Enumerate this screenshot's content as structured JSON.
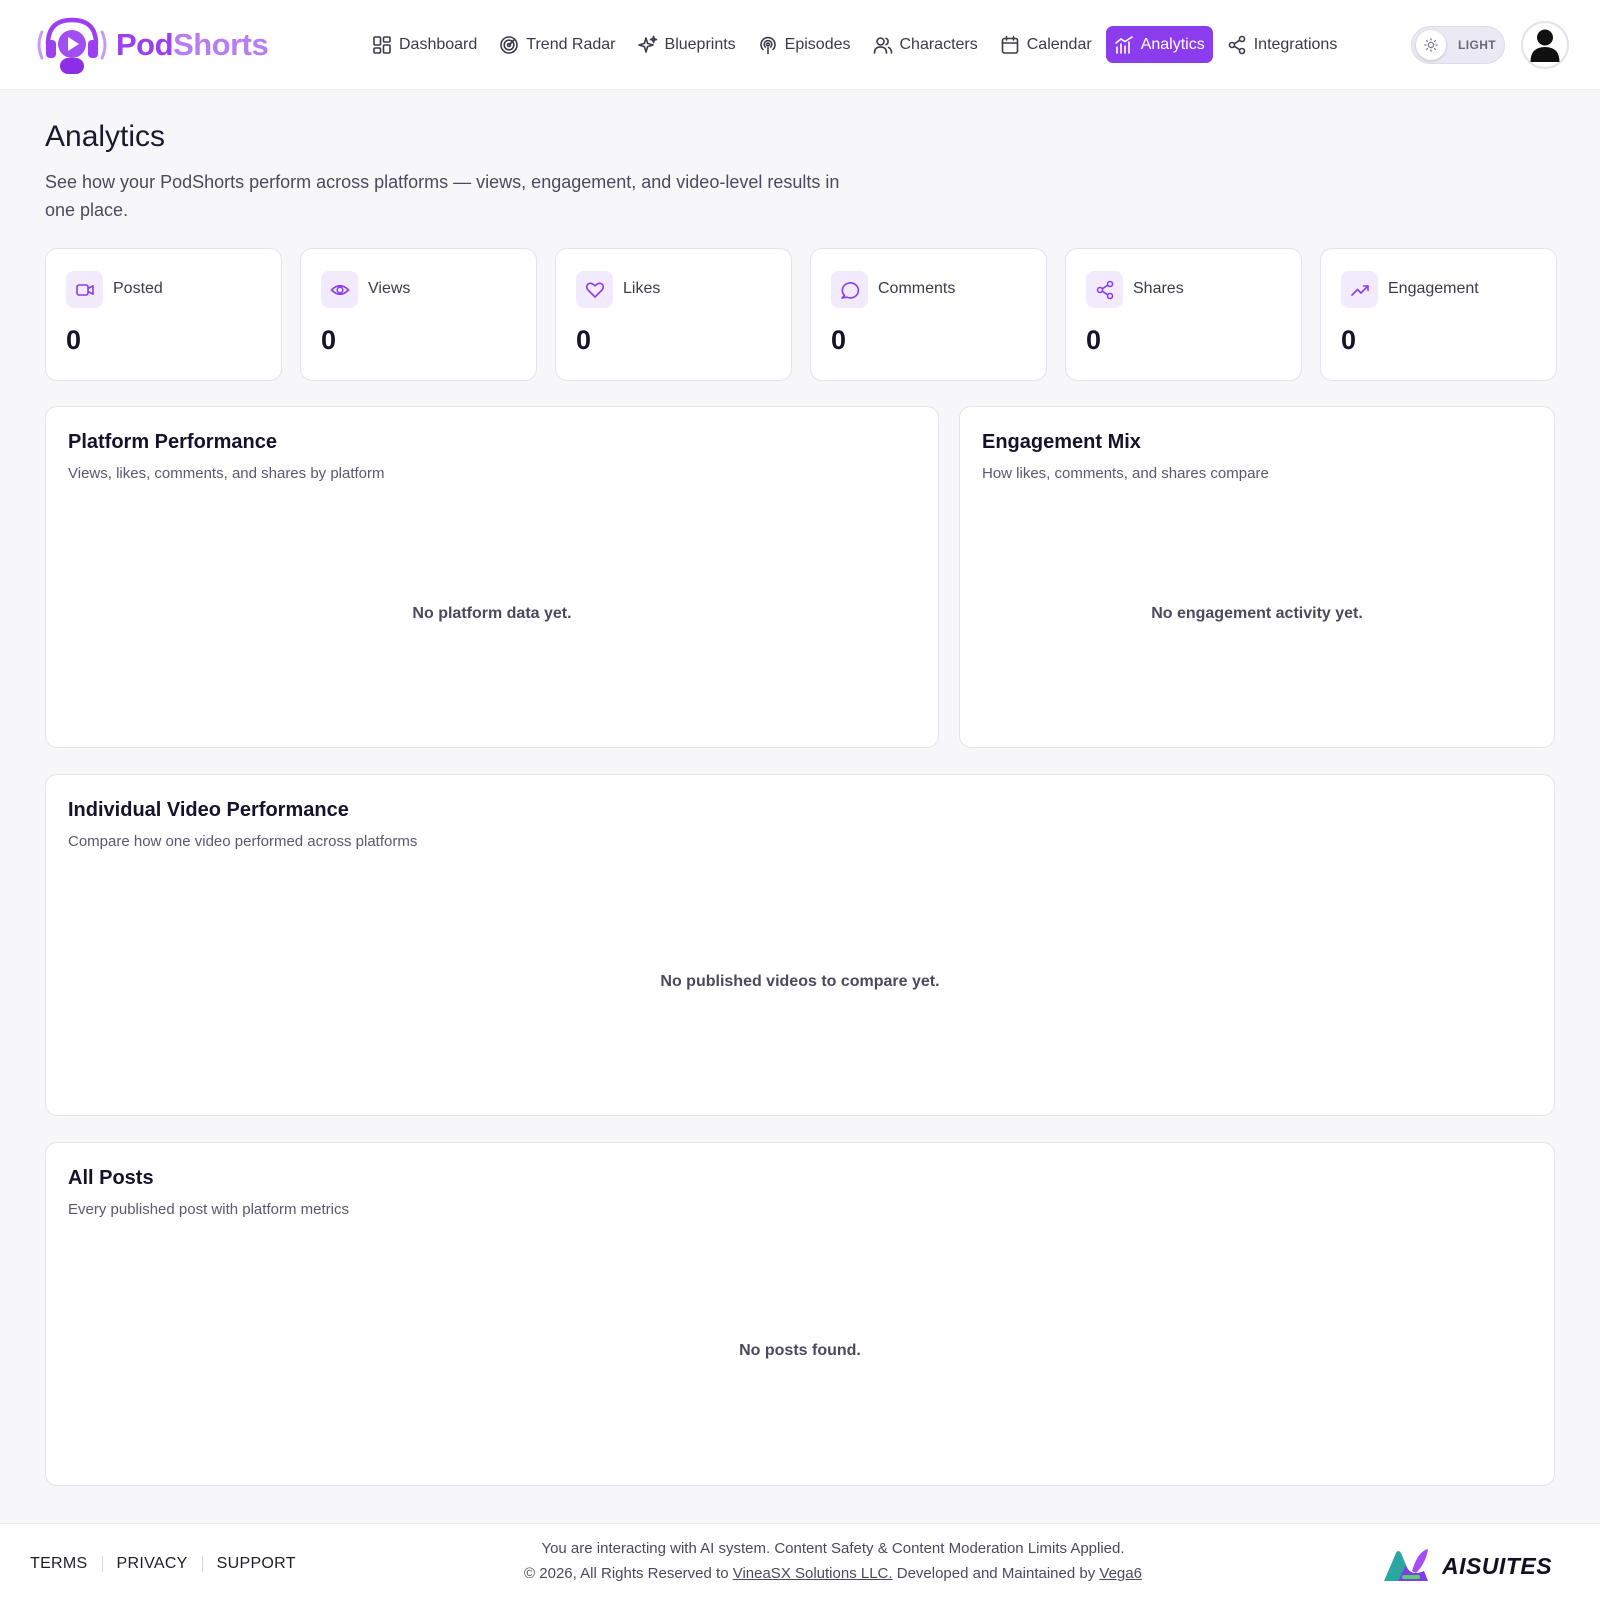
{
  "app": {
    "logo_part1": "Pod",
    "logo_part2": "Shorts",
    "accent_color": "#8b3dee"
  },
  "nav": {
    "items": [
      {
        "label": "Dashboard",
        "icon": "dashboard-grid-icon",
        "active": false
      },
      {
        "label": "Trend Radar",
        "icon": "radar-icon",
        "active": false
      },
      {
        "label": "Blueprints",
        "icon": "sparkles-icon",
        "active": false
      },
      {
        "label": "Episodes",
        "icon": "podcast-icon",
        "active": false
      },
      {
        "label": "Characters",
        "icon": "users-icon",
        "active": false
      },
      {
        "label": "Calendar",
        "icon": "calendar-icon",
        "active": false
      },
      {
        "label": "Analytics",
        "icon": "bar-chart-icon",
        "active": true
      },
      {
        "label": "Integrations",
        "icon": "share-nodes-icon",
        "active": false
      }
    ],
    "theme_label": "LIGHT"
  },
  "page": {
    "title": "Analytics",
    "subtitle": "See how your PodShorts perform across platforms — views, engagement, and video-level results in one place."
  },
  "stats": [
    {
      "label": "Posted",
      "value": "0",
      "icon": "video-camera-icon"
    },
    {
      "label": "Views",
      "value": "0",
      "icon": "eye-icon"
    },
    {
      "label": "Likes",
      "value": "0",
      "icon": "heart-icon"
    },
    {
      "label": "Comments",
      "value": "0",
      "icon": "chat-bubble-icon"
    },
    {
      "label": "Shares",
      "value": "0",
      "icon": "share-icon"
    },
    {
      "label": "Engagement",
      "value": "0",
      "icon": "trending-up-icon"
    }
  ],
  "panels": {
    "platform": {
      "title": "Platform Performance",
      "subtitle": "Views, likes, comments, and shares by platform",
      "empty": "No platform data yet."
    },
    "engagement": {
      "title": "Engagement Mix",
      "subtitle": "How likes, comments, and shares compare",
      "empty": "No engagement activity yet."
    },
    "video": {
      "title": "Individual Video Performance",
      "subtitle": "Compare how one video performed across platforms",
      "empty": "No published videos to compare yet."
    },
    "posts": {
      "title": "All Posts",
      "subtitle": "Every published post with platform metrics",
      "empty": "No posts found."
    }
  },
  "footer": {
    "links": [
      "TERMS",
      "PRIVACY",
      "SUPPORT"
    ],
    "notice": "You are interacting with AI system. Content Safety & Content Moderation Limits Applied.",
    "copy_prefix": "© 2026, All Rights Reserved to",
    "company": "VineaSX Solutions LLC.",
    "copy_middle": "Developed and Maintained by",
    "developer": "Vega6",
    "brand": "AISUITES"
  }
}
